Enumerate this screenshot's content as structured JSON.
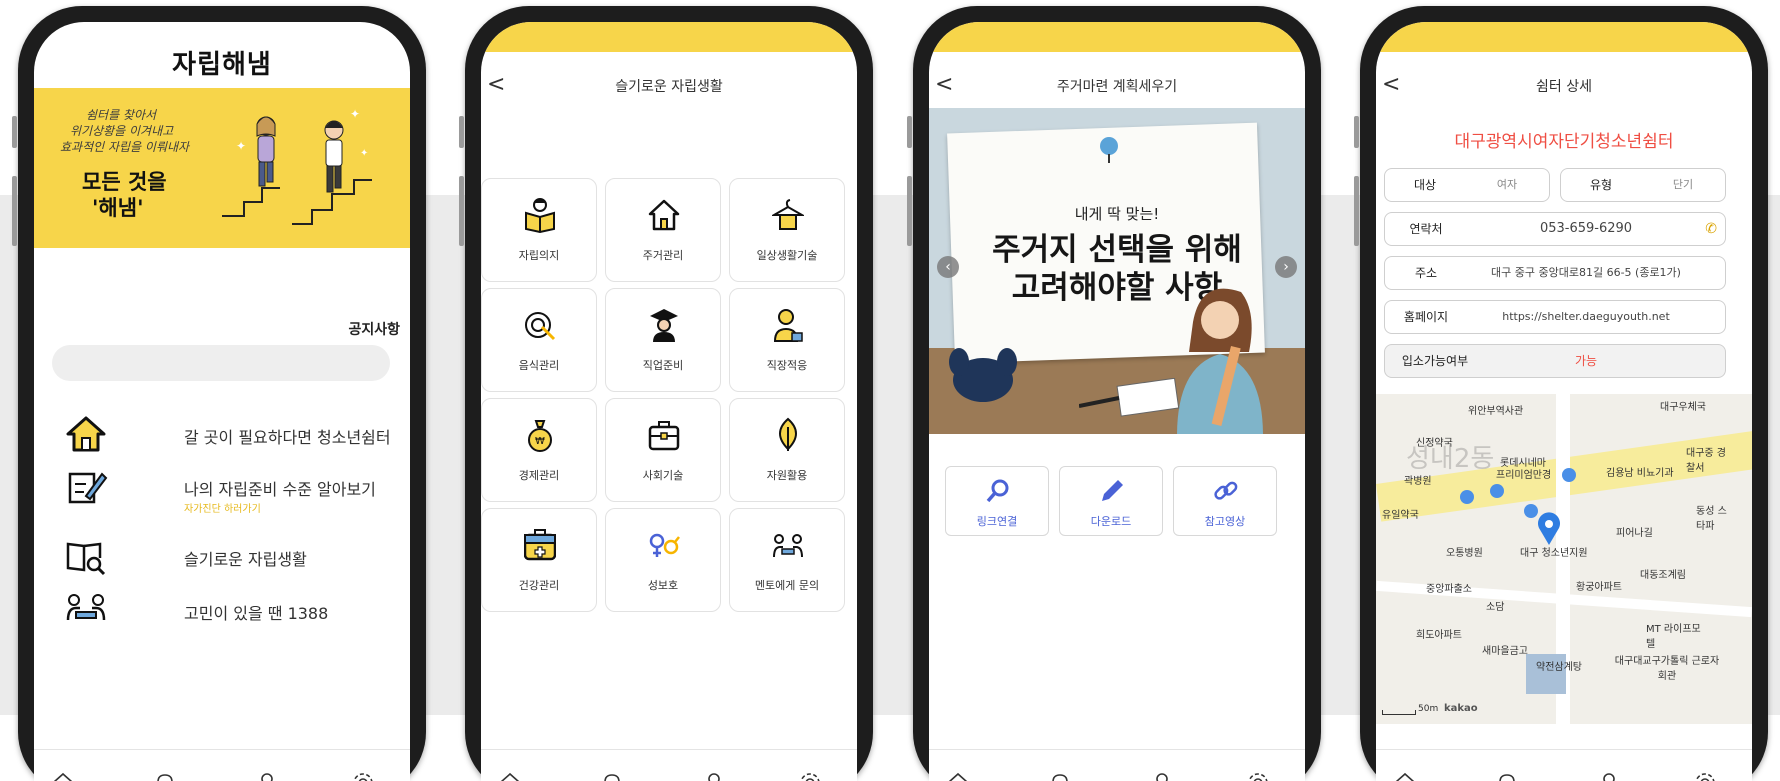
{
  "nav_icons": [
    "home-icon",
    "bell-icon",
    "user-icon",
    "settings-icon"
  ],
  "colors": {
    "accent_yellow": "#f7d54a",
    "red": "#ef4e43",
    "blue": "#4a62d6"
  },
  "screen1": {
    "title": "자립해냄",
    "banner": {
      "script_lines": [
        "쉼터를 찾아서",
        "위기상황을 이겨내고",
        "효과적인 자립을 이뤄내자"
      ],
      "headline_1": "모든 것을",
      "headline_2": "'해냄'"
    },
    "notice_label": "공지사항",
    "menu": [
      {
        "label": "갈 곳이 필요하다면 청소년쉼터",
        "icon": "house-icon"
      },
      {
        "label": "나의 자립준비 수준 알아보기",
        "sub": "자가진단 하러가기",
        "icon": "checklist-pen-icon"
      },
      {
        "label": "슬기로운 자립생활",
        "icon": "book-search-icon"
      },
      {
        "label": "고민이 있을 땐 1388",
        "icon": "counseling-icon"
      }
    ]
  },
  "screen2": {
    "header": "슬기로운 자립생활",
    "back_label": "<",
    "tiles": [
      "자립의지",
      "주거관리",
      "일상생활기술",
      "음식관리",
      "직업준비",
      "직장적응",
      "경제관리",
      "사회기술",
      "자원활용",
      "건강관리",
      "성보호",
      "멘토에게 문의"
    ]
  },
  "screen3": {
    "header": "주거마련 계획세우기",
    "back_label": "<",
    "image_text": {
      "line_small": "내게 딱 맞는!",
      "line_big_1": "주거지 선택을 위해",
      "line_big_2": "고려해야할 사항"
    },
    "buttons": [
      "링크연결",
      "다운로드",
      "참고영상"
    ]
  },
  "screen4": {
    "header": "쉼터 상세",
    "back_label": "<",
    "shelter_name": "대구광역시여자단기청소년쉼터",
    "target_label": "대상",
    "target_value": "여자",
    "type_label": "유형",
    "type_value": "단기",
    "contact_label": "연락처",
    "contact_value": "053-659-6290",
    "address_label": "주소",
    "address_value": "대구 중구 중앙대로81길 66-5 (종로1가)",
    "homepage_label": "홈페이지",
    "homepage_value": "https://shelter.daeguyouth.net",
    "admission_label": "입소가능여부",
    "admission_value": "가능",
    "map_labels": {
      "l1": "위안부역사관",
      "l2": "대구우체국",
      "l3": "신정약국",
      "l4": "롯데시네마",
      "l5": "프리미엄만경",
      "l6": "곽병원",
      "l7": "김용남 비뇨기과",
      "l8": "대구중 경찰서",
      "l9": "유일약국",
      "l10": "동성 스타파",
      "l11": "피어나길",
      "l12": "오통병원",
      "l13": "대구 청소년지원",
      "l14": "대동조계림",
      "l15": "중앙파출소",
      "l16": "황궁아파트",
      "l17": "소담",
      "l18": "MT 라이프모텔",
      "l19": "희도아파트",
      "l20": "새마을금고",
      "l21": "약전삼계탕",
      "l22": "대구대교구가톨릭 근로자회관",
      "l23": "성내2동",
      "scale": "50m",
      "brand": "kakao"
    }
  }
}
